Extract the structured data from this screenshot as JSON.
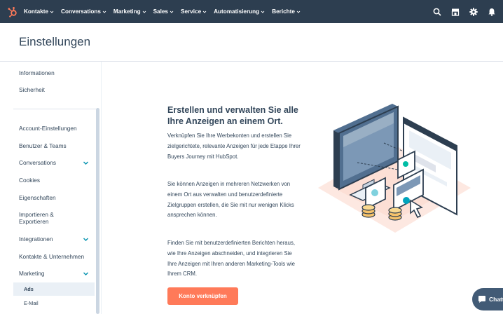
{
  "nav": {
    "items": [
      {
        "label": "Kontakte"
      },
      {
        "label": "Conversations"
      },
      {
        "label": "Marketing"
      },
      {
        "label": "Sales"
      },
      {
        "label": "Service"
      },
      {
        "label": "Automatisierung"
      },
      {
        "label": "Berichte"
      }
    ]
  },
  "page": {
    "title": "Einstellungen"
  },
  "sidebar": {
    "items": [
      {
        "label": "Informationen"
      },
      {
        "label": "Sicherheit"
      },
      {
        "label": "Account-Einstellungen"
      },
      {
        "label": "Benutzer & Teams"
      },
      {
        "label": "Conversations"
      },
      {
        "label": "Cookies"
      },
      {
        "label": "Eigenschaften"
      },
      {
        "label": "Importieren & Exportieren"
      },
      {
        "label": "Integrationen"
      },
      {
        "label": "Kontakte & Unternehmen"
      },
      {
        "label": "Marketing"
      }
    ],
    "subitems": [
      {
        "label": "Ads"
      },
      {
        "label": "E-Mail"
      }
    ]
  },
  "content": {
    "title": "Erstellen und verwalten Sie alle Ihre Anzeigen an einem Ort.",
    "paragraphs": [
      "Verknüpfen Sie Ihre Werbekonten und erstellen Sie zielgerichtete, relevante Anzeigen für jede Etappe Ihrer Buyers Journey mit HubSpot.",
      "Sie können Anzeigen in mehreren Netzwerken von einem Ort aus verwalten und benutzerdefinierte Zielgruppen erstellen, die Sie mit nur wenigen Klicks ansprechen können.",
      "Finden Sie mit benutzerdefinierten Berichten heraus, wie Ihre Anzeigen abschneiden, und integrieren Sie Ihre Anzeigen mit Ihren anderen Marketing-Tools wie Ihrem CRM."
    ],
    "button": "Konto verknüpfen"
  },
  "chat": {
    "label": "Chatt"
  },
  "colors": {
    "nav_bg": "#2d3e50",
    "accent": "#ff7a59",
    "teal": "#00a4bd"
  }
}
